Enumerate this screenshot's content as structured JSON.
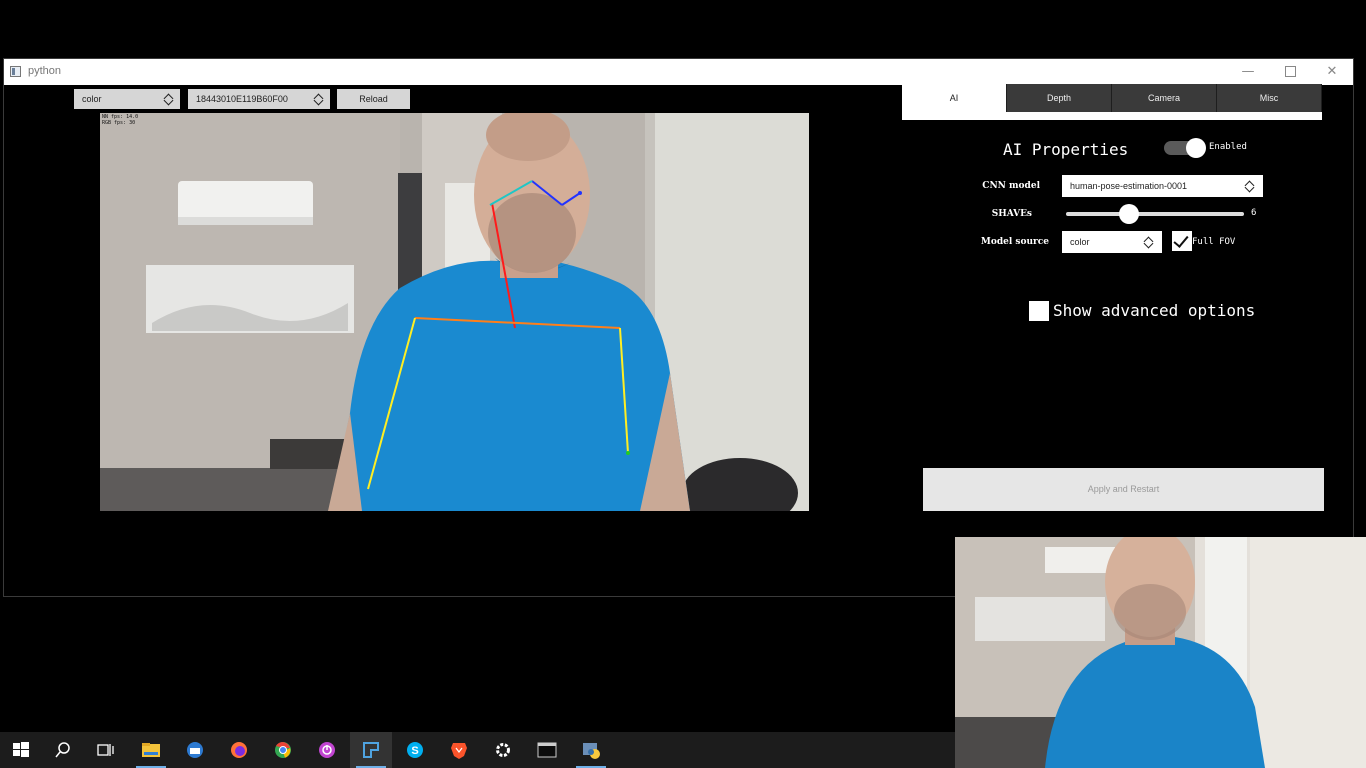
{
  "window": {
    "title": "python",
    "minimize_symbol": "—",
    "close_symbol": "✕"
  },
  "toolbar": {
    "source_value": "color",
    "device_value": "18443010E119B60F00",
    "reload_label": "Reload"
  },
  "video": {
    "overlay_line1": "NN fps: 14.0",
    "overlay_line2": "RGB fps: 30"
  },
  "tabs": [
    {
      "label": "AI",
      "active": true
    },
    {
      "label": "Depth",
      "active": false
    },
    {
      "label": "Camera",
      "active": false
    },
    {
      "label": "Misc",
      "active": false
    }
  ],
  "ai": {
    "title": "AI Properties",
    "enabled_label": "Enabled",
    "enabled": true,
    "cnn_model_label": "CNN model",
    "cnn_model_value": "human-pose-estimation-0001",
    "shaves_label": "SHAVEs",
    "shaves_value": "6",
    "model_source_label": "Model source",
    "model_source_value": "color",
    "full_fov_label": "Full FOV",
    "full_fov_checked": true,
    "advanced_label": "Show advanced options",
    "advanced_checked": false,
    "apply_label": "Apply and Restart"
  },
  "taskbar": {
    "items": [
      "windows-start",
      "search",
      "task-view",
      "file-explorer",
      "mail",
      "firefox",
      "chrome",
      "power-app",
      "depthai-app",
      "skype",
      "brave",
      "settings",
      "terminal",
      "python"
    ],
    "active_items": [
      "file-explorer",
      "depthai-app",
      "python"
    ]
  },
  "colors": {
    "tab_bg": "#3a3a3a",
    "accent": "#6fb0e8",
    "shirt": "#1a8ad0"
  }
}
